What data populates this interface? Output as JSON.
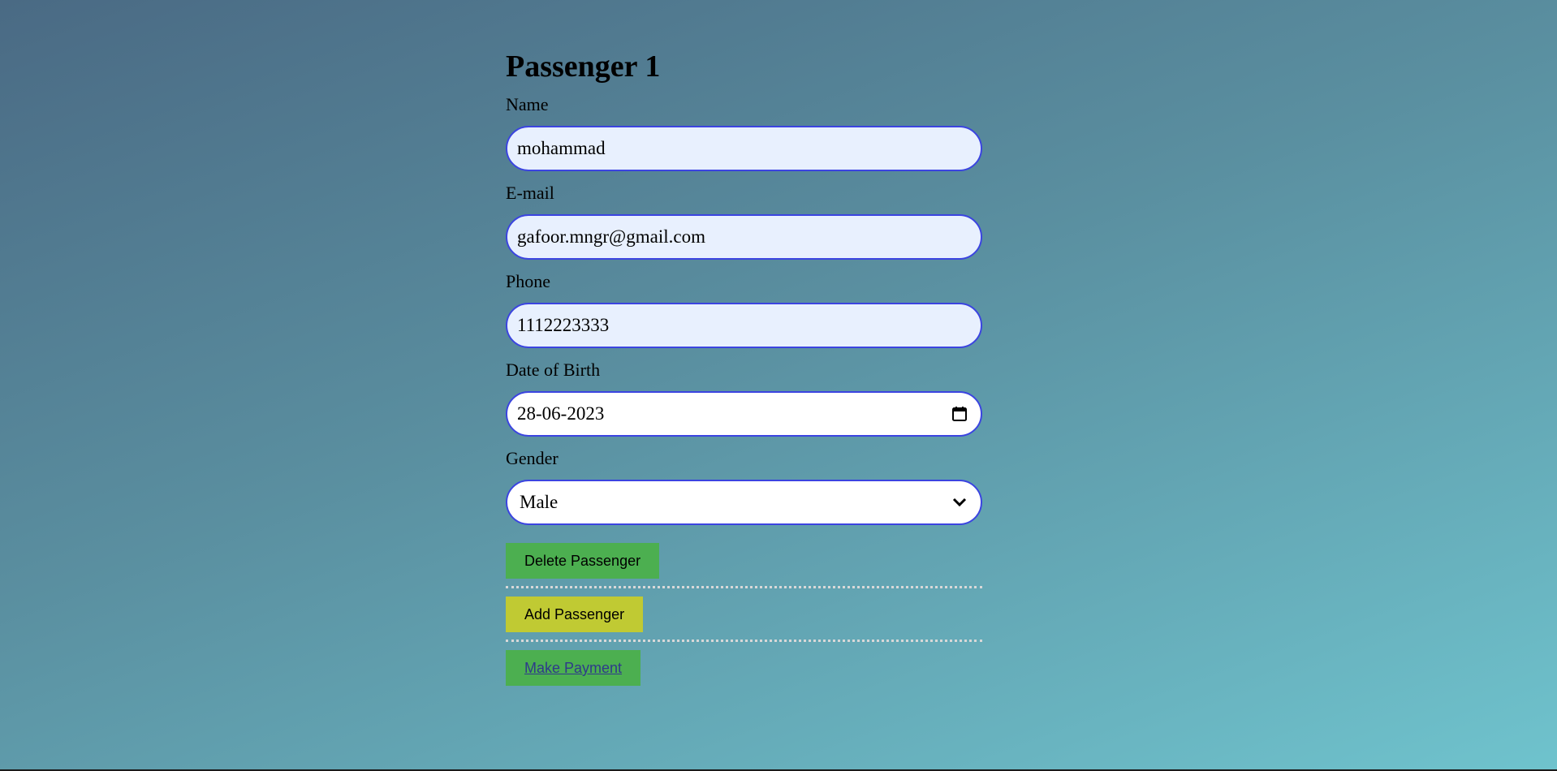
{
  "form": {
    "title": "Passenger 1",
    "name_label": "Name",
    "name_value": "mohammad",
    "email_label": "E-mail",
    "email_value": "gafoor.mngr@gmail.com",
    "phone_label": "Phone",
    "phone_value": "1112223333",
    "dob_label": "Date of Birth",
    "dob_value": "28-06-2023",
    "gender_label": "Gender",
    "gender_value": "Male"
  },
  "actions": {
    "delete_label": "Delete Passenger",
    "add_label": "Add Passenger",
    "payment_label": "Make Payment"
  },
  "icons": {
    "calendar": "calendar-icon",
    "chevron": "chevron-down-icon"
  },
  "colors": {
    "field_border": "#3b44e0",
    "autofill_bg": "#e8f0fe",
    "green_button": "#4caf50",
    "yellow_button": "#c0ca33"
  }
}
